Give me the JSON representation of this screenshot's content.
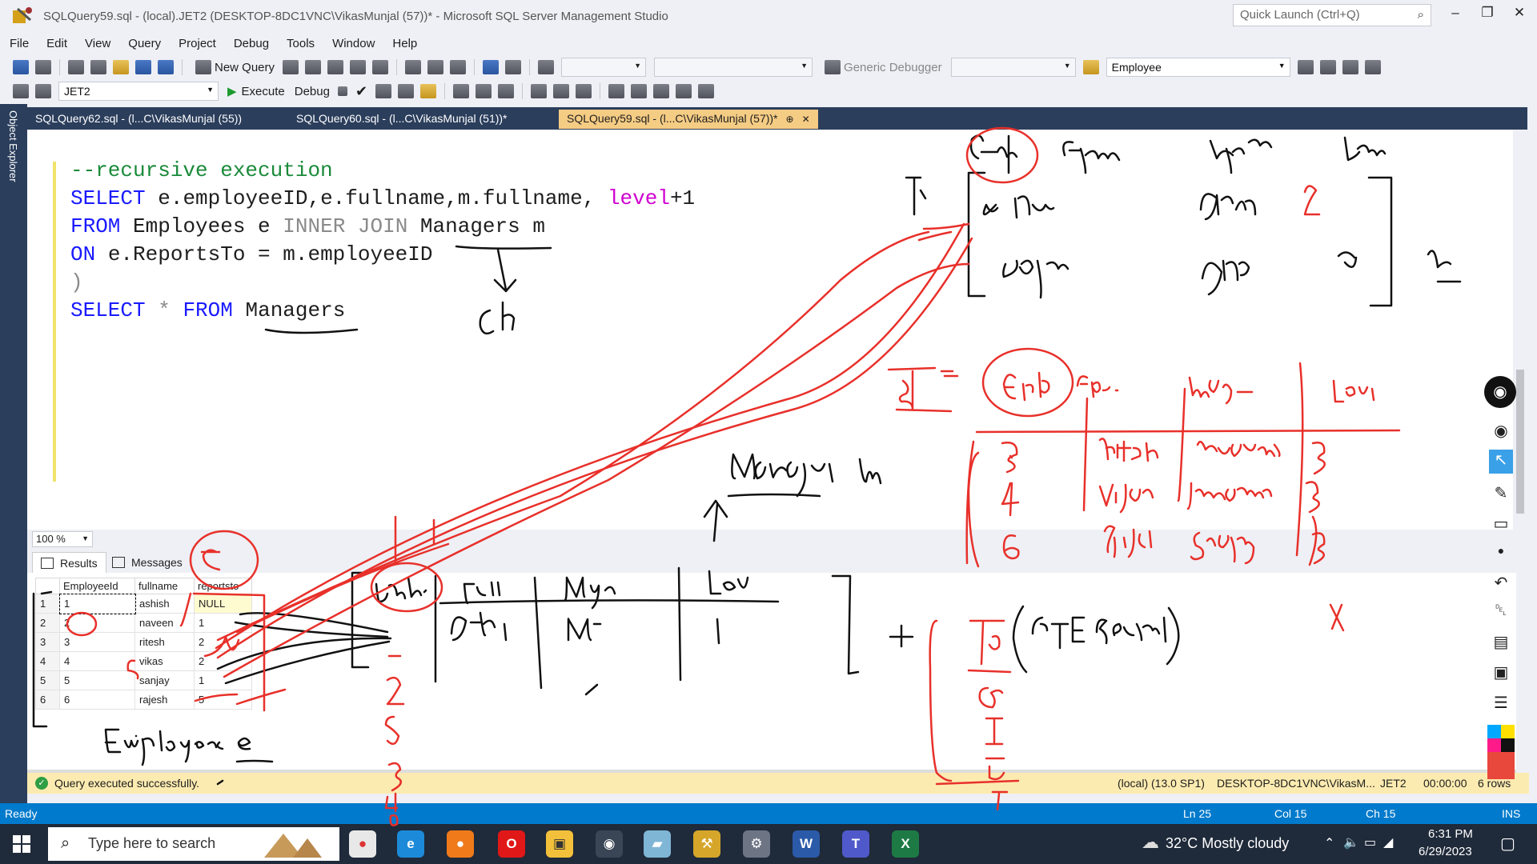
{
  "window": {
    "title": "SQLQuery59.sql - (local).JET2 (DESKTOP-8DC1VNC\\VikasMunjal (57))* - Microsoft SQL Server Management Studio",
    "quick_launch_placeholder": "Quick Launch (Ctrl+Q)"
  },
  "menu": [
    "File",
    "Edit",
    "View",
    "Query",
    "Project",
    "Debug",
    "Tools",
    "Window",
    "Help"
  ],
  "toolbar": {
    "new_query": "New Query",
    "generic_debugger": "Generic Debugger",
    "database_combo": "Employee",
    "server_combo": "JET2",
    "execute": "Execute",
    "debug": "Debug"
  },
  "object_explorer_label": "Object Explorer",
  "doc_tabs": [
    {
      "label": "SQLQuery62.sql - (l...C\\VikasMunjal (55))",
      "active": false
    },
    {
      "label": "SQLQuery60.sql - (l...C\\VikasMunjal (51))*",
      "active": false
    },
    {
      "label": "SQLQuery59.sql - (l...C\\VikasMunjal (57))*",
      "active": true
    }
  ],
  "editor": {
    "comment": "--recursive execution",
    "line2": {
      "kw1": "SELECT",
      "a": "e.employeeID,e.fullname,m.fullname,",
      "kw2": "level",
      "b": "+1"
    },
    "line3": {
      "kw1": "FROM",
      "a": "Employees e",
      "kw2": "INNER JOIN",
      "b": "Managers m"
    },
    "line4": {
      "kw1": "ON",
      "a": "e.ReportsTo = m.employeeID"
    },
    "line5": ")",
    "line6": {
      "kw1": "SELECT",
      "star": "*",
      "kw2": "FROM",
      "a": "Managers"
    }
  },
  "zoom": "100 %",
  "results": {
    "tabs": [
      "Results",
      "Messages"
    ],
    "columns": [
      "EmployeeId",
      "fullname",
      "reportsto"
    ],
    "rows": [
      {
        "n": "1",
        "id": "1",
        "name": "ashish",
        "rep": "NULL"
      },
      {
        "n": "2",
        "id": "2",
        "name": "naveen",
        "rep": "1"
      },
      {
        "n": "3",
        "id": "3",
        "name": "ritesh",
        "rep": "2"
      },
      {
        "n": "4",
        "id": "4",
        "name": "vikas",
        "rep": "2"
      },
      {
        "n": "5",
        "id": "5",
        "name": "sanjay",
        "rep": "1"
      },
      {
        "n": "6",
        "id": "6",
        "name": "rajesh",
        "rep": "5"
      }
    ]
  },
  "query_status": {
    "message": "Query executed successfully.",
    "server": "(local) (13.0 SP1)",
    "user": "DESKTOP-8DC1VNC\\VikasM...",
    "db": "JET2",
    "time": "00:00:00",
    "rows": "6 rows"
  },
  "statusbar": {
    "ready": "Ready",
    "ln": "Ln 25",
    "col": "Col 15",
    "ch": "Ch 15",
    "ins": "INS"
  },
  "taskbar": {
    "search_placeholder": "Type here to search",
    "weather": "32°C  Mostly cloudy",
    "time": "6:31 PM",
    "date": "6/29/2023"
  },
  "colors": {
    "accent": "#007acc",
    "ink_red": "#e8302a",
    "ink_black": "#111111",
    "tab_active": "#f5cc84"
  }
}
